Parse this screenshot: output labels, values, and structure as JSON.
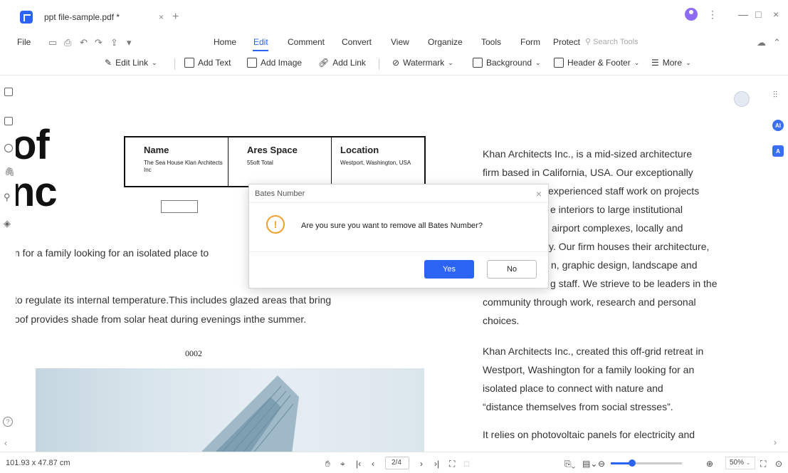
{
  "window": {
    "tab_title": "ppt file-sample.pdf *",
    "tab_close": "×",
    "new_tab": "+",
    "minimize": "—",
    "maximize": "□",
    "close": "×",
    "more": "⋮"
  },
  "menu": {
    "file": "File",
    "items": [
      "Home",
      "Edit",
      "Comment",
      "Convert",
      "View",
      "Organize",
      "Tools",
      "Form",
      "Protect"
    ],
    "active": "Edit",
    "search_placeholder": "Search Tools"
  },
  "toolbar": {
    "edit_link": "Edit Link",
    "add_text": "Add Text",
    "add_image": "Add Image",
    "add_link": "Add Link",
    "watermark": "Watermark",
    "background": "Background",
    "header_footer": "Header & Footer",
    "more": "More"
  },
  "document": {
    "big_word_1": "of",
    "big_word_2": "nc",
    "table": {
      "col1_header": "Name",
      "col1_value": "The Sea House Klan Architects Inc",
      "col2_header": "Ares Space",
      "col2_value": "55oft Total",
      "col3_header": "Location",
      "col3_value": "Westport, Washington, USA"
    },
    "left_line_1": "n for a family looking for an isolated place to",
    "left_line_2": "to regulate its internal temperature.This includes glazed areas that bring",
    "left_line_3": "oof provides shade from solar heat during evenings inthe summer.",
    "page_number": "0002",
    "right_para_1": [
      "Khan Architects Inc., is a mid-sized architecture",
      "firm based in California, USA. Our exceptionally",
      "experienced staff work on projects",
      "e interiors to large institutional",
      "airport complexes, locally and",
      "y. Our firm houses their architecture,",
      "n, graphic design, landscape and",
      "g staff. We strieve to be leaders in the",
      "community through work, research and personal",
      "choices."
    ],
    "right_para_2": [
      "Khan Architects Inc., created this off-grid retreat in",
      "Westport, Washington for a family looking for an",
      "isolated place to connect with nature and",
      "“distance themselves from social stresses”."
    ],
    "right_para_3": "It relies on photovoltaic panels for electricity and"
  },
  "dialog": {
    "title": "Bates Number",
    "message": "Are you sure you want to remove all Bates Number?",
    "yes": "Yes",
    "no": "No",
    "close": "×",
    "warn_glyph": "!"
  },
  "statusbar": {
    "dimensions": "101.93 x 47.87 cm",
    "page_value": "2/4",
    "zoom": "50%",
    "zoom_level": 0.3
  },
  "colors": {
    "accent": "#2b64f2",
    "warning": "#f0a02c"
  },
  "icons": {
    "page-thumbnails": "page-icon",
    "bookmark": "bookmark-icon",
    "comment": "comment-icon",
    "attachment": "paperclip-icon",
    "search": "search-icon",
    "layers": "layers-icon",
    "help": "help-icon"
  }
}
